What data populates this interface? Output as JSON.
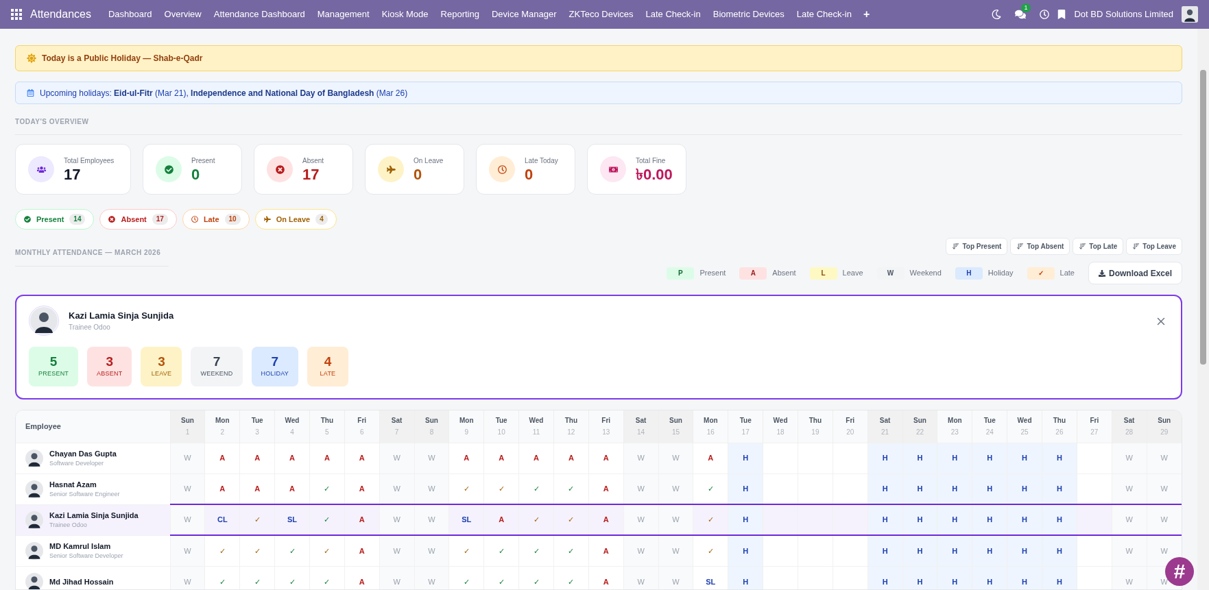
{
  "nav": {
    "app": "Attendances",
    "menu": [
      "Dashboard",
      "Overview",
      "Attendance Dashboard",
      "Management",
      "Kiosk Mode",
      "Reporting",
      "Device Manager",
      "ZKTeco Devices",
      "Late Check-in",
      "Biometric Devices",
      "Late Check-in"
    ],
    "add": "+",
    "chat_count": "1",
    "company": "Dot BD Solutions Limited"
  },
  "holiday_alert": "Today is a Public Holiday — Shab-e-Qadr",
  "upcoming": "Upcoming holidays: **Eid-ul-Fitr** (Mar 21), **Independence and National Day of Bangladesh** (Mar 26)",
  "overview": {
    "title": "TODAY'S OVERVIEW",
    "cards": [
      {
        "kind": "employees",
        "label": "Total Employees",
        "value": "17"
      },
      {
        "kind": "present",
        "label": "Present",
        "value": "0"
      },
      {
        "kind": "absent",
        "label": "Absent",
        "value": "17"
      },
      {
        "kind": "leave",
        "label": "On Leave",
        "value": "0"
      },
      {
        "kind": "late",
        "label": "Late Today",
        "value": "0"
      },
      {
        "kind": "fine",
        "label": "Total Fine",
        "value": "৳0.00"
      }
    ]
  },
  "filters": [
    {
      "kind": "present",
      "label": "Present",
      "count": "14"
    },
    {
      "kind": "absent",
      "label": "Absent",
      "count": "17"
    },
    {
      "kind": "late",
      "label": "Late",
      "count": "10"
    },
    {
      "kind": "leave",
      "label": "On Leave",
      "count": "4"
    }
  ],
  "monthly": {
    "title": "MONTHLY ATTENDANCE — MARCH 2026",
    "sort_buttons": [
      "Top Present",
      "Top Absent",
      "Top Late",
      "Top Leave"
    ],
    "legend": [
      {
        "kind": "present",
        "code": "P",
        "label": "Present"
      },
      {
        "kind": "absent",
        "code": "A",
        "label": "Absent"
      },
      {
        "kind": "leave",
        "code": "L",
        "label": "Leave"
      },
      {
        "kind": "weekend",
        "code": "W",
        "label": "Weekend"
      },
      {
        "kind": "holiday",
        "code": "H",
        "label": "Holiday"
      },
      {
        "kind": "late",
        "code": "✓",
        "label": "Late"
      }
    ],
    "download": "Download Excel"
  },
  "employee_card": {
    "name": "Kazi Lamia Sinja Sunjida",
    "role": "Trainee Odoo",
    "stats": [
      {
        "kind": "present",
        "value": "5",
        "label": "PRESENT"
      },
      {
        "kind": "absent",
        "value": "3",
        "label": "ABSENT"
      },
      {
        "kind": "leave",
        "value": "3",
        "label": "LEAVE"
      },
      {
        "kind": "weekend",
        "value": "7",
        "label": "WEEKEND"
      },
      {
        "kind": "holiday",
        "value": "7",
        "label": "HOLIDAY"
      },
      {
        "kind": "late",
        "value": "4",
        "label": "LATE"
      }
    ]
  },
  "table": {
    "employee_header": "Employee",
    "days": [
      {
        "weekday": "Sun",
        "day": "1",
        "kind": "weekend"
      },
      {
        "weekday": "Mon",
        "day": "2",
        "kind": "workday"
      },
      {
        "weekday": "Tue",
        "day": "3",
        "kind": "workday"
      },
      {
        "weekday": "Wed",
        "day": "4",
        "kind": "workday"
      },
      {
        "weekday": "Thu",
        "day": "5",
        "kind": "workday"
      },
      {
        "weekday": "Fri",
        "day": "6",
        "kind": "workday"
      },
      {
        "weekday": "Sat",
        "day": "7",
        "kind": "weekend"
      },
      {
        "weekday": "Sun",
        "day": "8",
        "kind": "weekend"
      },
      {
        "weekday": "Mon",
        "day": "9",
        "kind": "workday"
      },
      {
        "weekday": "Tue",
        "day": "10",
        "kind": "workday"
      },
      {
        "weekday": "Wed",
        "day": "11",
        "kind": "workday"
      },
      {
        "weekday": "Thu",
        "day": "12",
        "kind": "workday"
      },
      {
        "weekday": "Fri",
        "day": "13",
        "kind": "workday"
      },
      {
        "weekday": "Sat",
        "day": "14",
        "kind": "weekend"
      },
      {
        "weekday": "Sun",
        "day": "15",
        "kind": "weekend"
      },
      {
        "weekday": "Mon",
        "day": "16",
        "kind": "workday"
      },
      {
        "weekday": "Tue",
        "day": "17",
        "kind": "workday"
      },
      {
        "weekday": "Wed",
        "day": "18",
        "kind": "workday"
      },
      {
        "weekday": "Thu",
        "day": "19",
        "kind": "workday"
      },
      {
        "weekday": "Fri",
        "day": "20",
        "kind": "workday"
      },
      {
        "weekday": "Sat",
        "day": "21",
        "kind": "weekend"
      },
      {
        "weekday": "Sun",
        "day": "22",
        "kind": "weekend"
      },
      {
        "weekday": "Mon",
        "day": "23",
        "kind": "workday"
      },
      {
        "weekday": "Tue",
        "day": "24",
        "kind": "workday"
      },
      {
        "weekday": "Wed",
        "day": "25",
        "kind": "workday"
      },
      {
        "weekday": "Thu",
        "day": "26",
        "kind": "workday"
      },
      {
        "weekday": "Fri",
        "day": "27",
        "kind": "workday"
      },
      {
        "weekday": "Sat",
        "day": "28",
        "kind": "weekend"
      },
      {
        "weekday": "Sun",
        "day": "29",
        "kind": "weekend"
      }
    ],
    "rows": [
      {
        "name": "Chayan Das Gupta",
        "role": "Software Developer",
        "selected": false,
        "cells": [
          {
            "kind": "weekend",
            "text": "W"
          },
          {
            "kind": "absent",
            "text": "A"
          },
          {
            "kind": "absent",
            "text": "A"
          },
          {
            "kind": "absent",
            "text": "A"
          },
          {
            "kind": "absent",
            "text": "A"
          },
          {
            "kind": "absent",
            "text": "A"
          },
          {
            "kind": "weekend",
            "text": "W"
          },
          {
            "kind": "weekend",
            "text": "W"
          },
          {
            "kind": "absent",
            "text": "A"
          },
          {
            "kind": "absent",
            "text": "A"
          },
          {
            "kind": "absent",
            "text": "A"
          },
          {
            "kind": "absent",
            "text": "A"
          },
          {
            "kind": "absent",
            "text": "A"
          },
          {
            "kind": "weekend",
            "text": "W"
          },
          {
            "kind": "weekend",
            "text": "W"
          },
          {
            "kind": "absent",
            "text": "A"
          },
          {
            "kind": "holiday",
            "text": "H"
          },
          {
            "kind": "empty"
          },
          {
            "kind": "empty"
          },
          {
            "kind": "empty"
          },
          {
            "kind": "holiday",
            "text": "H"
          },
          {
            "kind": "holiday",
            "text": "H"
          },
          {
            "kind": "holiday",
            "text": "H"
          },
          {
            "kind": "holiday",
            "text": "H"
          },
          {
            "kind": "holiday",
            "text": "H"
          },
          {
            "kind": "holiday",
            "text": "H"
          },
          {
            "kind": "empty"
          },
          {
            "kind": "weekend",
            "text": "W"
          },
          {
            "kind": "weekend",
            "text": "W"
          }
        ]
      },
      {
        "name": "Hasnat Azam",
        "role": "Senior Software Engineer",
        "selected": false,
        "cells": [
          {
            "kind": "weekend",
            "text": "W"
          },
          {
            "kind": "absent",
            "text": "A"
          },
          {
            "kind": "absent",
            "text": "A"
          },
          {
            "kind": "absent",
            "text": "A"
          },
          {
            "kind": "present",
            "text": "✓"
          },
          {
            "kind": "absent",
            "text": "A"
          },
          {
            "kind": "weekend",
            "text": "W"
          },
          {
            "kind": "weekend",
            "text": "W"
          },
          {
            "kind": "late",
            "text": "✓"
          },
          {
            "kind": "late",
            "text": "✓"
          },
          {
            "kind": "present",
            "text": "✓"
          },
          {
            "kind": "present",
            "text": "✓"
          },
          {
            "kind": "absent",
            "text": "A"
          },
          {
            "kind": "weekend",
            "text": "W"
          },
          {
            "kind": "weekend",
            "text": "W"
          },
          {
            "kind": "present",
            "text": "✓"
          },
          {
            "kind": "holiday",
            "text": "H"
          },
          {
            "kind": "empty"
          },
          {
            "kind": "empty"
          },
          {
            "kind": "empty"
          },
          {
            "kind": "holiday",
            "text": "H"
          },
          {
            "kind": "holiday",
            "text": "H"
          },
          {
            "kind": "holiday",
            "text": "H"
          },
          {
            "kind": "holiday",
            "text": "H"
          },
          {
            "kind": "holiday",
            "text": "H"
          },
          {
            "kind": "holiday",
            "text": "H"
          },
          {
            "kind": "empty"
          },
          {
            "kind": "weekend",
            "text": "W"
          },
          {
            "kind": "weekend",
            "text": "W"
          }
        ]
      },
      {
        "name": "Kazi Lamia Sinja Sunjida",
        "role": "Trainee Odoo",
        "selected": true,
        "cells": [
          {
            "kind": "weekend",
            "text": "W"
          },
          {
            "kind": "leave",
            "text": "CL"
          },
          {
            "kind": "late",
            "text": "✓"
          },
          {
            "kind": "leave",
            "text": "SL"
          },
          {
            "kind": "present",
            "text": "✓"
          },
          {
            "kind": "absent",
            "text": "A"
          },
          {
            "kind": "weekend",
            "text": "W"
          },
          {
            "kind": "weekend",
            "text": "W"
          },
          {
            "kind": "leave",
            "text": "SL"
          },
          {
            "kind": "absent",
            "text": "A"
          },
          {
            "kind": "late",
            "text": "✓"
          },
          {
            "kind": "late",
            "text": "✓"
          },
          {
            "kind": "absent",
            "text": "A"
          },
          {
            "kind": "weekend",
            "text": "W"
          },
          {
            "kind": "weekend",
            "text": "W"
          },
          {
            "kind": "late",
            "text": "✓"
          },
          {
            "kind": "holiday",
            "text": "H"
          },
          {
            "kind": "empty"
          },
          {
            "kind": "empty"
          },
          {
            "kind": "empty"
          },
          {
            "kind": "holiday",
            "text": "H"
          },
          {
            "kind": "holiday",
            "text": "H"
          },
          {
            "kind": "holiday",
            "text": "H"
          },
          {
            "kind": "holiday",
            "text": "H"
          },
          {
            "kind": "holiday",
            "text": "H"
          },
          {
            "kind": "holiday",
            "text": "H"
          },
          {
            "kind": "empty"
          },
          {
            "kind": "weekend",
            "text": "W"
          },
          {
            "kind": "weekend",
            "text": "W"
          }
        ]
      },
      {
        "name": "MD Kamrul Islam",
        "role": "Senior Software Developer",
        "selected": false,
        "cells": [
          {
            "kind": "weekend",
            "text": "W"
          },
          {
            "kind": "late",
            "text": "✓"
          },
          {
            "kind": "late",
            "text": "✓"
          },
          {
            "kind": "present",
            "text": "✓"
          },
          {
            "kind": "late",
            "text": "✓"
          },
          {
            "kind": "absent",
            "text": "A"
          },
          {
            "kind": "weekend",
            "text": "W"
          },
          {
            "kind": "weekend",
            "text": "W"
          },
          {
            "kind": "late",
            "text": "✓"
          },
          {
            "kind": "present",
            "text": "✓"
          },
          {
            "kind": "present",
            "text": "✓"
          },
          {
            "kind": "present",
            "text": "✓"
          },
          {
            "kind": "absent",
            "text": "A"
          },
          {
            "kind": "weekend",
            "text": "W"
          },
          {
            "kind": "weekend",
            "text": "W"
          },
          {
            "kind": "late",
            "text": "✓"
          },
          {
            "kind": "holiday",
            "text": "H"
          },
          {
            "kind": "empty"
          },
          {
            "kind": "empty"
          },
          {
            "kind": "empty"
          },
          {
            "kind": "holiday",
            "text": "H"
          },
          {
            "kind": "holiday",
            "text": "H"
          },
          {
            "kind": "holiday",
            "text": "H"
          },
          {
            "kind": "holiday",
            "text": "H"
          },
          {
            "kind": "holiday",
            "text": "H"
          },
          {
            "kind": "holiday",
            "text": "H"
          },
          {
            "kind": "empty"
          },
          {
            "kind": "weekend",
            "text": "W"
          },
          {
            "kind": "weekend",
            "text": "W"
          }
        ]
      },
      {
        "name": "Md Jihad Hossain",
        "selected": false,
        "cells": [
          {
            "kind": "weekend",
            "text": "W"
          },
          {
            "kind": "present",
            "text": "✓"
          },
          {
            "kind": "present",
            "text": "✓"
          },
          {
            "kind": "present",
            "text": "✓"
          },
          {
            "kind": "present",
            "text": "✓"
          },
          {
            "kind": "absent",
            "text": "A"
          },
          {
            "kind": "weekend",
            "text": "W"
          },
          {
            "kind": "weekend",
            "text": "W"
          },
          {
            "kind": "present",
            "text": "✓"
          },
          {
            "kind": "present",
            "text": "✓"
          },
          {
            "kind": "present",
            "text": "✓"
          },
          {
            "kind": "present",
            "text": "✓"
          },
          {
            "kind": "absent",
            "text": "A"
          },
          {
            "kind": "weekend",
            "text": "W"
          },
          {
            "kind": "weekend",
            "text": "W"
          },
          {
            "kind": "leave",
            "text": "SL"
          },
          {
            "kind": "holiday",
            "text": "H"
          },
          {
            "kind": "empty"
          },
          {
            "kind": "empty"
          },
          {
            "kind": "empty"
          },
          {
            "kind": "holiday",
            "text": "H"
          },
          {
            "kind": "holiday",
            "text": "H"
          },
          {
            "kind": "holiday",
            "text": "H"
          },
          {
            "kind": "holiday",
            "text": "H"
          },
          {
            "kind": "holiday",
            "text": "H"
          },
          {
            "kind": "holiday",
            "text": "H"
          },
          {
            "kind": "empty"
          },
          {
            "kind": "weekend",
            "text": "W"
          },
          {
            "kind": "weekend",
            "text": "W"
          }
        ]
      }
    ]
  },
  "fab": "#"
}
